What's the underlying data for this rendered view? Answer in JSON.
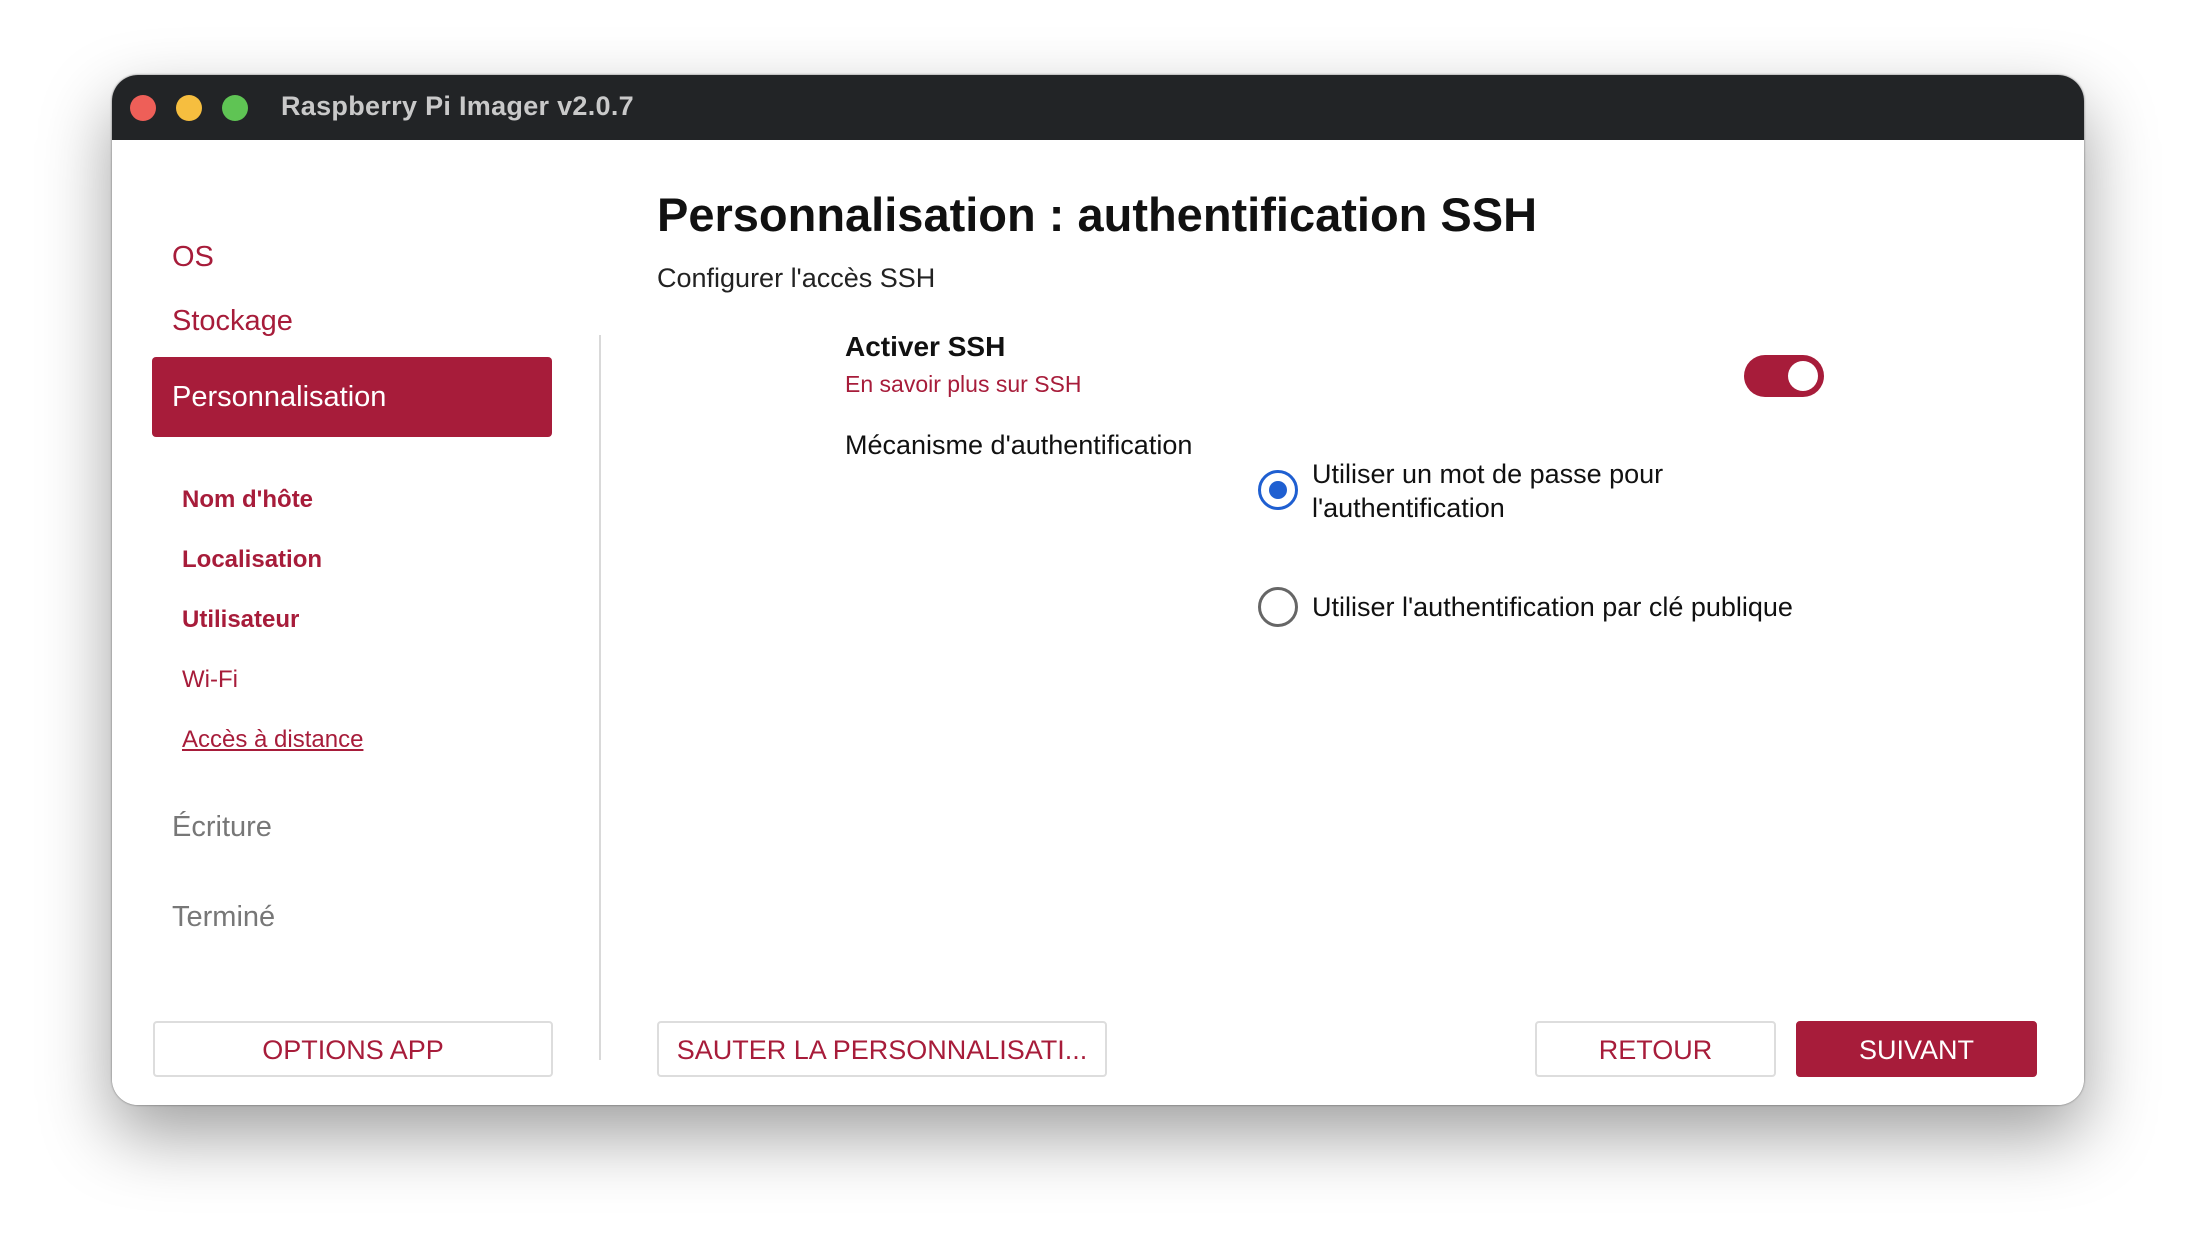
{
  "window": {
    "title": "Raspberry Pi Imager v2.0.7"
  },
  "sidebar": {
    "items": [
      {
        "label": "OS",
        "state": "done"
      },
      {
        "label": "Stockage",
        "state": "done"
      },
      {
        "label": "Personnalisation",
        "state": "active"
      },
      {
        "label": "Écriture",
        "state": "disabled"
      },
      {
        "label": "Terminé",
        "state": "disabled"
      }
    ],
    "sub_items": [
      {
        "label": "Nom d'hôte"
      },
      {
        "label": "Localisation"
      },
      {
        "label": "Utilisateur"
      },
      {
        "label": "Wi-Fi"
      },
      {
        "label": "Accès à distance"
      }
    ]
  },
  "main": {
    "title": "Personnalisation : authentification SSH",
    "subtitle": "Configurer l'accès SSH",
    "ssh": {
      "label": "Activer SSH",
      "link": "En savoir plus sur SSH",
      "enabled": true
    },
    "auth": {
      "label": "Mécanisme d'authentification",
      "options": [
        {
          "label_line1": "Utiliser un mot de passe pour",
          "label_line2": "l'authentification",
          "checked": true
        },
        {
          "label_line1": "Utiliser l'authentification par clé publique",
          "checked": false
        }
      ]
    }
  },
  "footer": {
    "options_app": "OPTIONS APP",
    "skip": "SAUTER LA PERSONNALISATI...",
    "back": "RETOUR",
    "next": "SUIVANT"
  },
  "colors": {
    "accent": "#a71c3a",
    "radio_selected": "#1f5fd1",
    "titlebar": "#222426"
  }
}
